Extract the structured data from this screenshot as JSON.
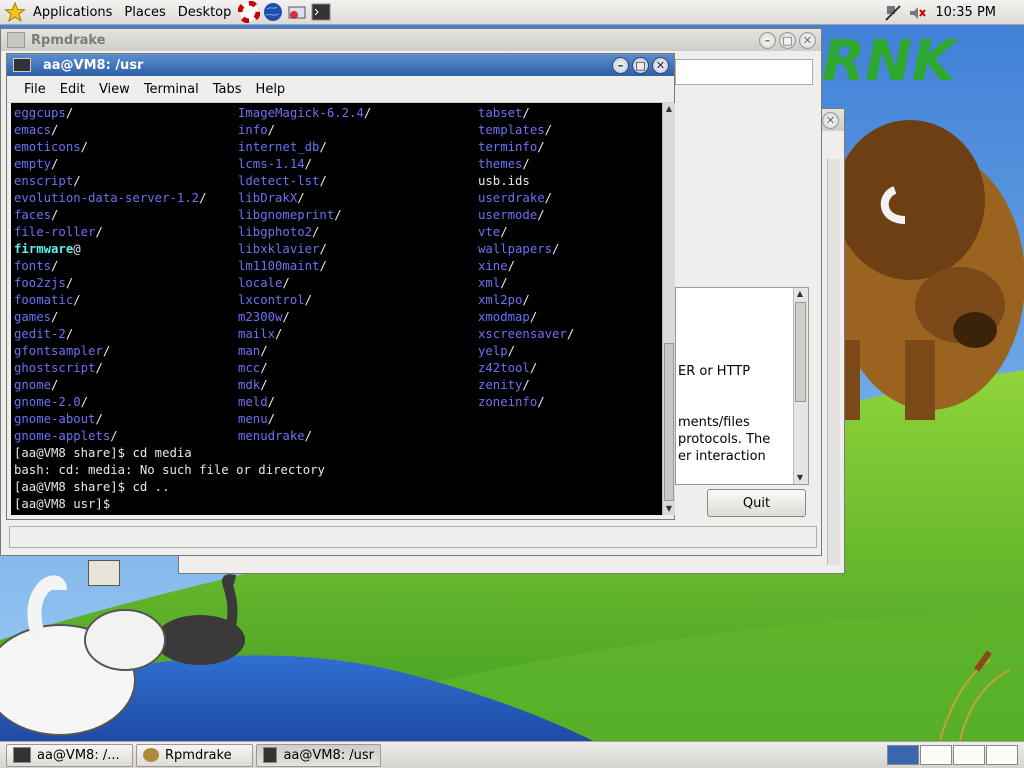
{
  "top_panel": {
    "menus": [
      "Applications",
      "Places",
      "Desktop"
    ],
    "clock": "10:35 PM",
    "launchers": [
      "help-lifebuoy-icon",
      "web-browser-globe-icon",
      "mail-icon",
      "terminal-icon"
    ]
  },
  "rpmdrake": {
    "title": "Rpmdrake",
    "help_lines": [
      "ER or HTTP",
      "ments/files",
      "protocols. The",
      "er interaction"
    ],
    "quit_label": "Quit"
  },
  "terminal": {
    "title": "aa@VM8: /usr",
    "menu": [
      "File",
      "Edit",
      "View",
      "Terminal",
      "Tabs",
      "Help"
    ],
    "col1": [
      {
        "t": "eggcups",
        "s": "/",
        "k": "dir"
      },
      {
        "t": "emacs",
        "s": "/",
        "k": "dir"
      },
      {
        "t": "emoticons",
        "s": "/",
        "k": "dir"
      },
      {
        "t": "empty",
        "s": "/",
        "k": "dir"
      },
      {
        "t": "enscript",
        "s": "/",
        "k": "dir"
      },
      {
        "t": "evolution-data-server-1.2",
        "s": "/",
        "k": "dir"
      },
      {
        "t": "faces",
        "s": "/",
        "k": "dir"
      },
      {
        "t": "file-roller",
        "s": "/",
        "k": "dir"
      },
      {
        "t": "firmware",
        "s": "@",
        "k": "sym"
      },
      {
        "t": "fonts",
        "s": "/",
        "k": "dir"
      },
      {
        "t": "foo2zjs",
        "s": "/",
        "k": "dir"
      },
      {
        "t": "foomatic",
        "s": "/",
        "k": "dir"
      },
      {
        "t": "games",
        "s": "/",
        "k": "dir"
      },
      {
        "t": "gedit-2",
        "s": "/",
        "k": "dir"
      },
      {
        "t": "gfontsampler",
        "s": "/",
        "k": "dir"
      },
      {
        "t": "ghostscript",
        "s": "/",
        "k": "dir"
      },
      {
        "t": "gnome",
        "s": "/",
        "k": "dir"
      },
      {
        "t": "gnome-2.0",
        "s": "/",
        "k": "dir"
      },
      {
        "t": "gnome-about",
        "s": "/",
        "k": "dir"
      },
      {
        "t": "gnome-applets",
        "s": "/",
        "k": "dir"
      }
    ],
    "col2": [
      {
        "t": "ImageMagick-6.2.4",
        "s": "/",
        "k": "dir"
      },
      {
        "t": "info",
        "s": "/",
        "k": "dir"
      },
      {
        "t": "internet_db",
        "s": "/",
        "k": "dir"
      },
      {
        "t": "lcms-1.14",
        "s": "/",
        "k": "dir"
      },
      {
        "t": "ldetect-lst",
        "s": "/",
        "k": "dir"
      },
      {
        "t": "libDrakX",
        "s": "/",
        "k": "dir"
      },
      {
        "t": "libgnomeprint",
        "s": "/",
        "k": "dir"
      },
      {
        "t": "libgphoto2",
        "s": "/",
        "k": "dir"
      },
      {
        "t": "libxklavier",
        "s": "/",
        "k": "dir"
      },
      {
        "t": "lm1100maint",
        "s": "/",
        "k": "dir"
      },
      {
        "t": "locale",
        "s": "/",
        "k": "dir"
      },
      {
        "t": "lxcontrol",
        "s": "/",
        "k": "dir"
      },
      {
        "t": "m2300w",
        "s": "/",
        "k": "dir"
      },
      {
        "t": "mailx",
        "s": "/",
        "k": "dir"
      },
      {
        "t": "man",
        "s": "/",
        "k": "dir"
      },
      {
        "t": "mcc",
        "s": "/",
        "k": "dir"
      },
      {
        "t": "mdk",
        "s": "/",
        "k": "dir"
      },
      {
        "t": "meld",
        "s": "/",
        "k": "dir"
      },
      {
        "t": "menu",
        "s": "/",
        "k": "dir"
      },
      {
        "t": "menudrake",
        "s": "/",
        "k": "dir"
      }
    ],
    "col3": [
      {
        "t": "tabset",
        "s": "/",
        "k": "dir"
      },
      {
        "t": "templates",
        "s": "/",
        "k": "dir"
      },
      {
        "t": "terminfo",
        "s": "/",
        "k": "dir"
      },
      {
        "t": "themes",
        "s": "/",
        "k": "dir"
      },
      {
        "t": "usb.ids",
        "s": "",
        "k": "file"
      },
      {
        "t": "userdrake",
        "s": "/",
        "k": "dir"
      },
      {
        "t": "usermode",
        "s": "/",
        "k": "dir"
      },
      {
        "t": "vte",
        "s": "/",
        "k": "dir"
      },
      {
        "t": "wallpapers",
        "s": "/",
        "k": "dir"
      },
      {
        "t": "xine",
        "s": "/",
        "k": "dir"
      },
      {
        "t": "xml",
        "s": "/",
        "k": "dir"
      },
      {
        "t": "xml2po",
        "s": "/",
        "k": "dir"
      },
      {
        "t": "xmodmap",
        "s": "/",
        "k": "dir"
      },
      {
        "t": "xscreensaver",
        "s": "/",
        "k": "dir"
      },
      {
        "t": "yelp",
        "s": "/",
        "k": "dir"
      },
      {
        "t": "z42tool",
        "s": "/",
        "k": "dir"
      },
      {
        "t": "zenity",
        "s": "/",
        "k": "dir"
      },
      {
        "t": "zoneinfo",
        "s": "/",
        "k": "dir"
      }
    ],
    "lines": [
      "[aa@VM8 share]$ cd media",
      "bash: cd: media: No such file or directory",
      "[aa@VM8 share]$ cd ..",
      "[aa@VM8 usr]$ "
    ]
  },
  "taskbar": {
    "tasks": [
      {
        "label": "aa@VM8: /...",
        "icon": "terminal-icon"
      },
      {
        "label": "Rpmdrake",
        "icon": "rpmdrake-icon"
      },
      {
        "label": "aa@VM8: /usr",
        "icon": "terminal-icon"
      }
    ],
    "workspaces": 4
  },
  "wallpaper": {
    "logo_text": "RNK"
  },
  "colors": {
    "dir": "#6f6ff6",
    "symlink": "#5ef0f0",
    "title_active": "#2d5ea8"
  }
}
